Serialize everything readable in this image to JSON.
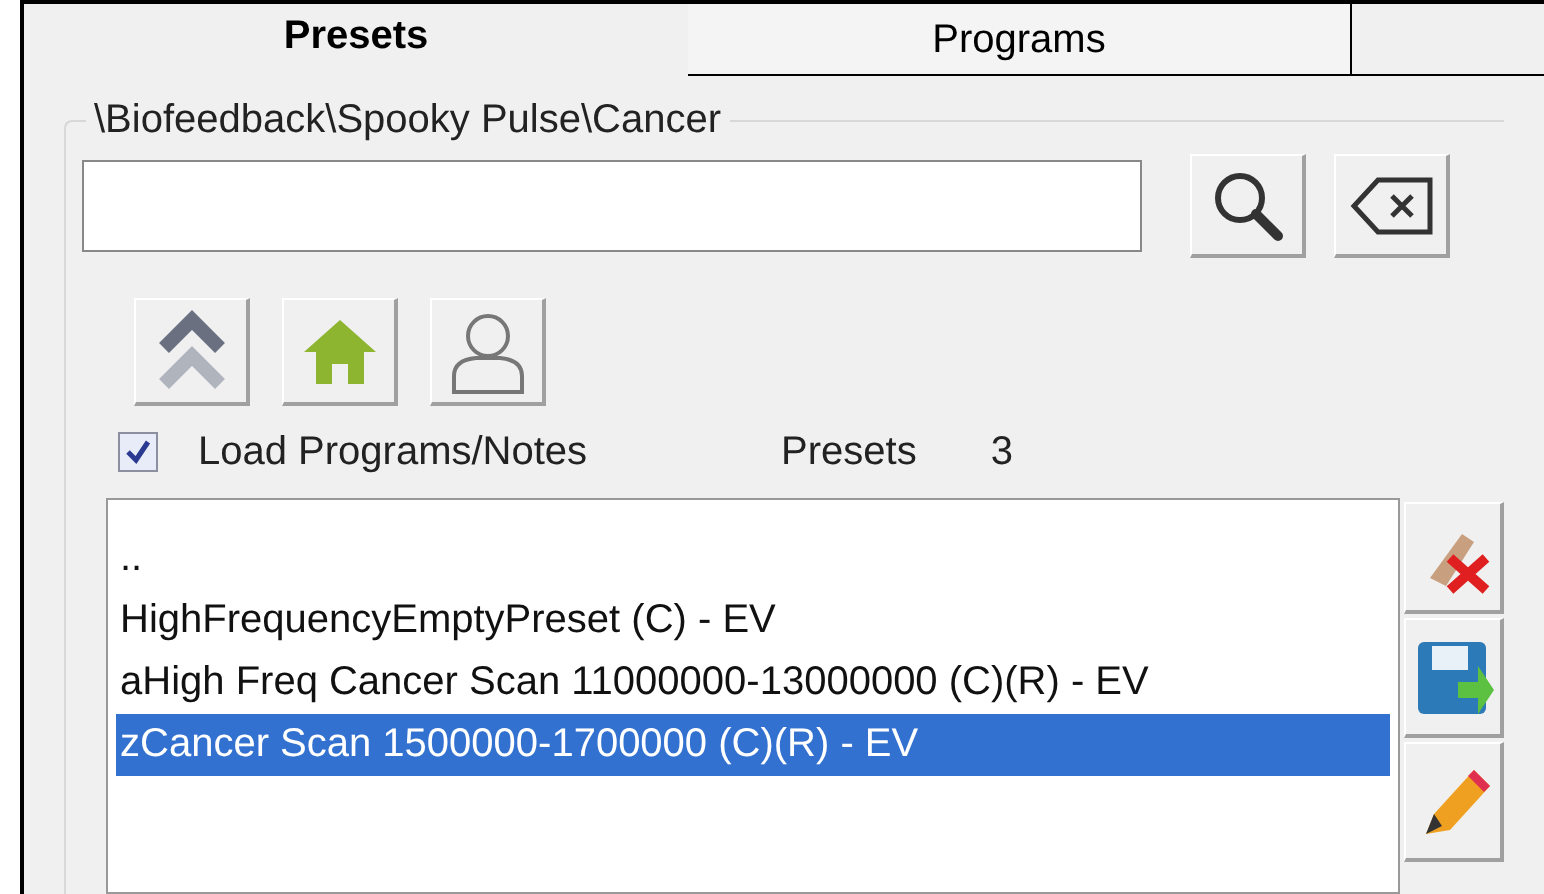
{
  "tabs": [
    {
      "label": "Presets",
      "selected": true
    },
    {
      "label": "Programs",
      "selected": false
    }
  ],
  "path": "\\Biofeedback\\Spooky Pulse\\Cancer",
  "load_programs": {
    "label": "Load Programs/Notes",
    "checked": true
  },
  "presets_count": {
    "label": "Presets",
    "value": "3"
  },
  "list": [
    {
      "text": "..",
      "selected": false
    },
    {
      "text": "HighFrequencyEmptyPreset (C) - EV",
      "selected": false
    },
    {
      "text": "aHigh Freq Cancer Scan 11000000-13000000 (C)(R) - EV",
      "selected": false
    },
    {
      "text": "zCancer Scan 1500000-1700000 (C)(R) - EV",
      "selected": true
    }
  ]
}
